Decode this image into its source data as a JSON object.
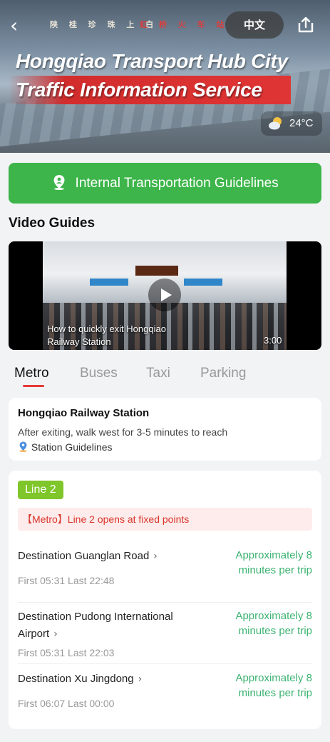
{
  "header": {
    "language_label": "中文",
    "title_line1": "Hongqiao Transport Hub City",
    "title_line2": "Traffic Information Service",
    "temperature": "24°C",
    "weather_icon": "partly-cloudy-icon"
  },
  "guidelines_button": {
    "label": "Internal Transportation Guidelines"
  },
  "video": {
    "section_title": "Video Guides",
    "caption": "How to quickly exit Hongqiao Railway Station",
    "duration": "3:00"
  },
  "tabs": [
    {
      "label": "Metro",
      "active": true
    },
    {
      "label": "Buses",
      "active": false
    },
    {
      "label": "Taxi",
      "active": false
    },
    {
      "label": "Parking",
      "active": false
    }
  ],
  "station": {
    "name": "Hongqiao Railway Station",
    "description": "After exiting, walk west for 3-5 minutes to reach",
    "link_label": "Station Guidelines"
  },
  "line": {
    "badge": "Line 2",
    "badge_color": "#7fc62a",
    "notice": "【Metro】Line 2 opens at fixed points",
    "destinations": [
      {
        "name": "Destination Guanglan Road",
        "times": "First 05:31  Last 22:48",
        "frequency": "Approximately 8 minutes per trip"
      },
      {
        "name": "Destination Pudong International Airport",
        "times": "First 05:31  Last 22:03",
        "frequency": "Approximately 8 minutes per trip"
      },
      {
        "name": "Destination Xu Jingdong",
        "times": "First 06:07  Last 00:00",
        "frequency": "Approximately 8 minutes per trip"
      }
    ]
  },
  "colors": {
    "accent_green": "#3db54a",
    "tab_indicator": "#e53935",
    "frequency_text": "#3cb371",
    "notice_text": "#d9342b"
  }
}
